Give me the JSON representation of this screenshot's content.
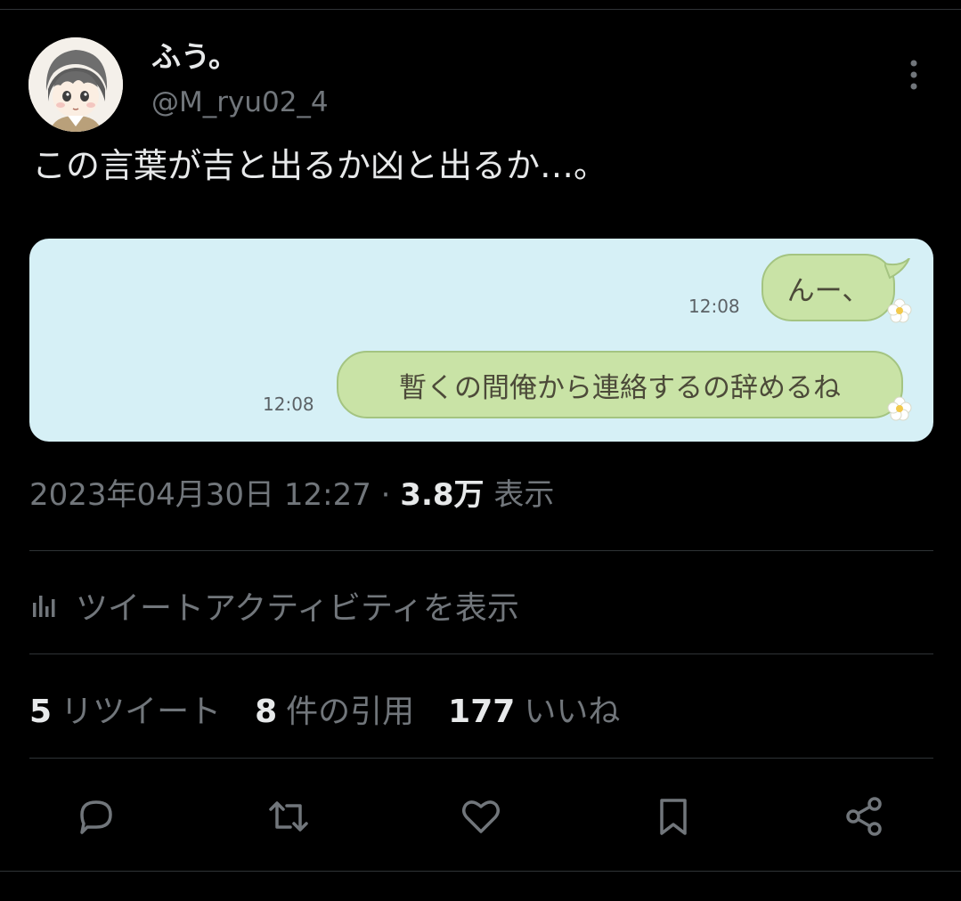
{
  "author": {
    "display_name": "ふう。",
    "handle": "@M_ryu02_4",
    "avatar_icon": "anime-avatar-icon"
  },
  "tweet": {
    "text": "この言葉が吉と出るか凶と出るか…。"
  },
  "media": {
    "background_color": "#d6f0f6",
    "bubble_color": "#c9e3a6",
    "messages": [
      {
        "text": "んー、",
        "time": "12:08"
      },
      {
        "text": "暫くの間俺から連絡するの辞めるね",
        "time": "12:08"
      }
    ]
  },
  "meta": {
    "timestamp": "2023年04月30日 12:27",
    "separator": "·",
    "views_count": "3.8万",
    "views_label": "表示"
  },
  "activity": {
    "label": "ツイートアクティビティを表示",
    "icon": "analytics-bar-icon"
  },
  "stats": {
    "retweets_count": "5",
    "retweets_label": "リツイート",
    "quotes_count": "8",
    "quotes_label": "件の引用",
    "likes_count": "177",
    "likes_label": "いいね"
  },
  "actions": {
    "icons": [
      "reply-icon",
      "retweet-icon",
      "like-icon",
      "bookmark-icon",
      "share-icon"
    ]
  },
  "colors": {
    "background": "#000000",
    "text_primary": "#e7e9ea",
    "text_secondary": "#71767b",
    "divider": "#2f3336"
  }
}
